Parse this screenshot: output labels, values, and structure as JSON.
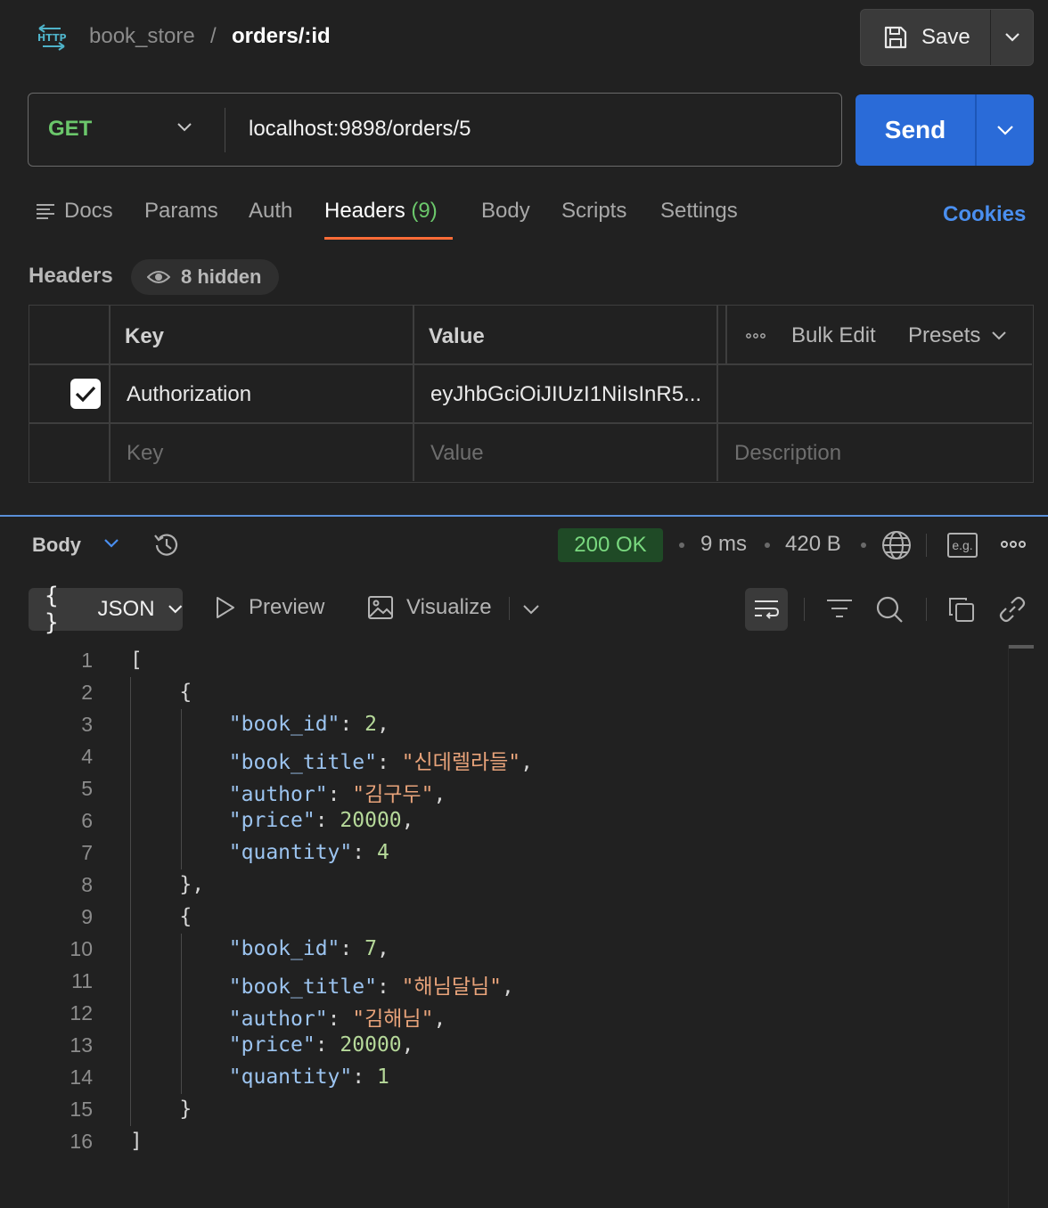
{
  "header": {
    "protocol_icon": "http-icon",
    "collection": "book_store",
    "separator": "/",
    "request_name": "orders/:id",
    "save_label": "Save"
  },
  "request": {
    "method": "GET",
    "url": "localhost:9898/orders/5",
    "send_label": "Send"
  },
  "tabs": {
    "docs": "Docs",
    "params": "Params",
    "auth": "Auth",
    "headers": "Headers",
    "headers_count": "(9)",
    "body": "Body",
    "scripts": "Scripts",
    "settings": "Settings",
    "cookies": "Cookies",
    "active": "Headers"
  },
  "headers_section": {
    "title": "Headers",
    "hidden_label": "8 hidden",
    "columns": {
      "key": "Key",
      "value": "Value",
      "bulk_edit": "Bulk Edit",
      "presets": "Presets"
    },
    "rows": [
      {
        "checked": true,
        "key": "Authorization",
        "value": "eyJhbGciOiJIUzI1NiIsInR5..."
      }
    ],
    "placeholders": {
      "key": "Key",
      "value": "Value",
      "description": "Description"
    }
  },
  "response": {
    "section_label": "Body",
    "status": "200 OK",
    "time": "9 ms",
    "size": "420 B",
    "eg_label": "e.g.",
    "format": "JSON",
    "preview": "Preview",
    "visualize": "Visualize",
    "colors": {
      "status_bg": "#1f4a26",
      "status_text": "#79d87f",
      "accent": "#ff6c37",
      "send": "#2a6bd8"
    }
  },
  "code_lines": [
    {
      "n": "1",
      "t": "["
    },
    {
      "n": "2",
      "t": "    {"
    },
    {
      "n": "3",
      "t": "        \"book_id\": 2,"
    },
    {
      "n": "4",
      "t": "        \"book_title\": \"신데렐라들\","
    },
    {
      "n": "5",
      "t": "        \"author\": \"김구두\","
    },
    {
      "n": "6",
      "t": "        \"price\": 20000,"
    },
    {
      "n": "7",
      "t": "        \"quantity\": 4"
    },
    {
      "n": "8",
      "t": "    },"
    },
    {
      "n": "9",
      "t": "    {"
    },
    {
      "n": "10",
      "t": "        \"book_id\": 7,"
    },
    {
      "n": "11",
      "t": "        \"book_title\": \"해님달님\","
    },
    {
      "n": "12",
      "t": "        \"author\": \"김해님\","
    },
    {
      "n": "13",
      "t": "        \"price\": 20000,"
    },
    {
      "n": "14",
      "t": "        \"quantity\": 1"
    },
    {
      "n": "15",
      "t": "    }"
    },
    {
      "n": "16",
      "t": "]"
    }
  ]
}
